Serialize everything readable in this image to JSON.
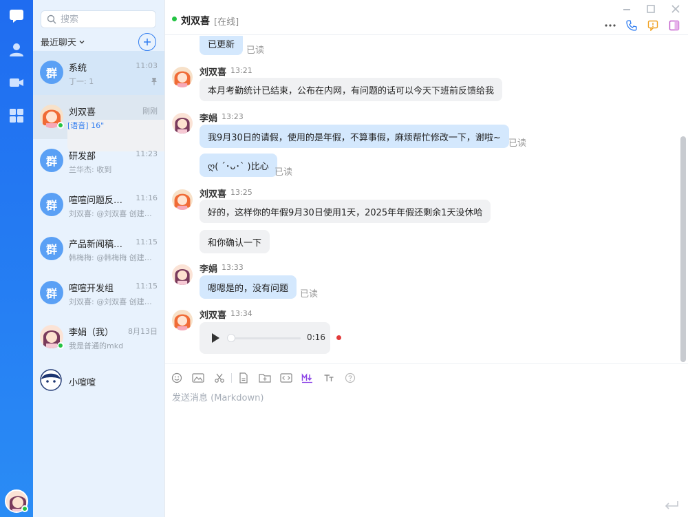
{
  "nav": {
    "items": [
      {
        "name": "chat-nav-icon"
      },
      {
        "name": "contacts-nav-icon"
      },
      {
        "name": "meeting-nav-icon"
      },
      {
        "name": "apps-nav-icon"
      }
    ]
  },
  "sidebar": {
    "search_placeholder": "搜索",
    "recent_label": "最近聊天",
    "conversations": [
      {
        "name": "系统",
        "time": "11:03",
        "preview": "丁一: 1",
        "avatar_text": "群",
        "pinned": true
      },
      {
        "name": "刘双喜",
        "time": "刚刚",
        "preview": "[语音] 16\"",
        "online": true
      },
      {
        "name": "研发部",
        "time": "11:23",
        "preview": "兰华杰: 收到",
        "avatar_text": "群"
      },
      {
        "name": "喧喧问题反馈群",
        "time": "11:16",
        "preview": "刘双喜: @刘双喜 创建了群",
        "avatar_text": "群"
      },
      {
        "name": "产品新闻稿讨论群",
        "time": "11:15",
        "preview": "韩梅梅: @韩梅梅 创建了群",
        "avatar_text": "群"
      },
      {
        "name": "喧喧开发组",
        "time": "11:15",
        "preview": "刘双喜: @刘双喜 创建了群",
        "avatar_text": "群"
      },
      {
        "name": "李娟（我）",
        "time": "8月13日",
        "preview": "我是普通的mkd",
        "online": true
      },
      {
        "name": "小喧喧",
        "time": "",
        "preview": ""
      }
    ]
  },
  "chat": {
    "name": "刘双喜",
    "status": "[在线]",
    "read_label": "已读",
    "messages": [
      {
        "text": "已更新",
        "read": true
      },
      {
        "sender": "刘双喜",
        "time": "13:21",
        "text": "本月考勤统计已结束，公布在内网，有问题的话可以今天下班前反馈给我"
      },
      {
        "sender": "李娟",
        "time": "13:23",
        "text": "我9月30日的请假，使用的是年假，不算事假，麻烦帮忙修改一下，谢啦~",
        "read": true
      },
      {
        "text": "ღ( ´･ᴗ･` )比心",
        "read": true
      },
      {
        "sender": "刘双喜",
        "time": "13:25",
        "text": "好的，这样你的年假9月30日使用1天，2025年年假还剩余1天没休哈"
      },
      {
        "text": "和你确认一下"
      },
      {
        "sender": "李娟",
        "time": "13:33",
        "text": "嗯嗯是的，没有问题",
        "read": true
      },
      {
        "sender": "刘双喜",
        "time": "13:34",
        "voice_duration": "0:16",
        "played_fraction": 0
      }
    ]
  },
  "composer": {
    "placeholder": "发送消息 (Markdown)"
  },
  "colors": {
    "rail": "#1f6cf0",
    "accent": "#2f7cf0",
    "online": "#23c343",
    "bubble_me": "#d4e8fd",
    "bubble_other": "#f0f1f3"
  }
}
